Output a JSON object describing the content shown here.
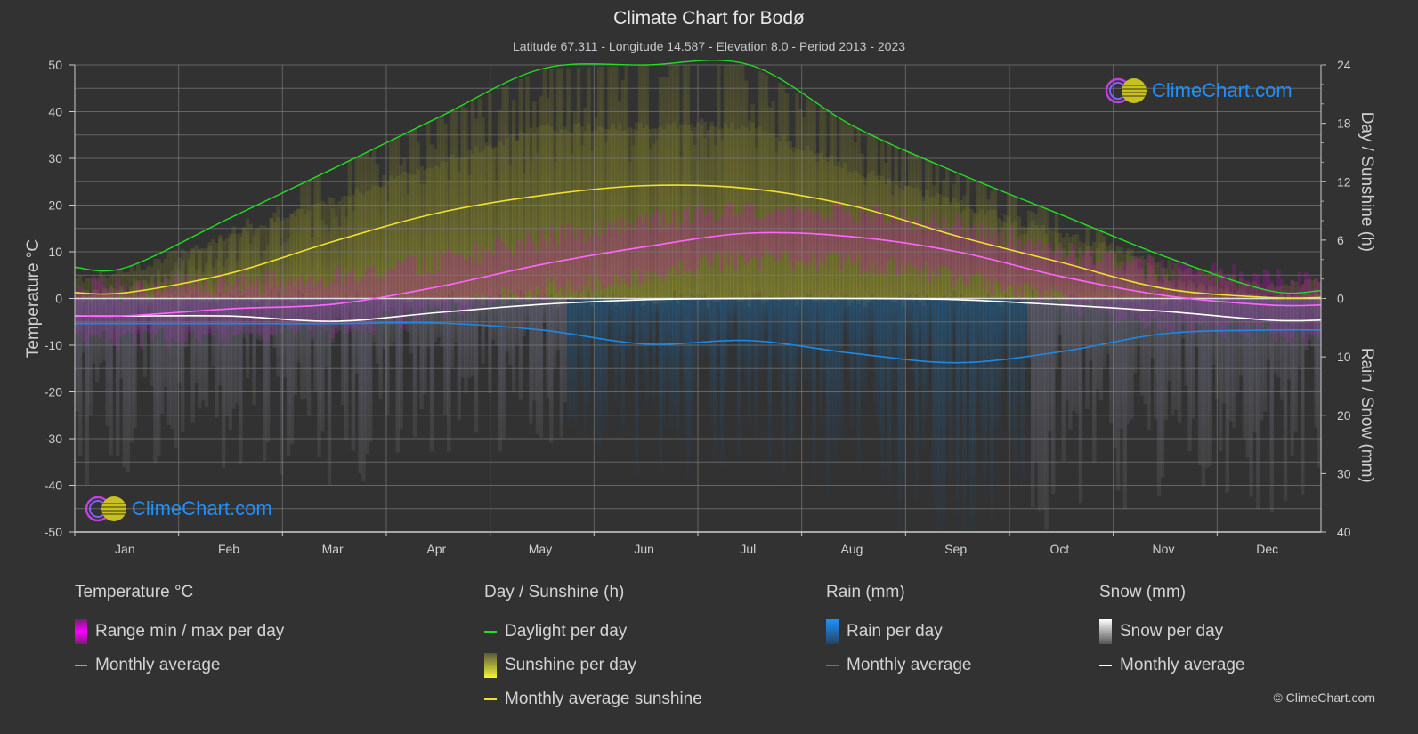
{
  "header": {
    "title": "Climate Chart for Bodø",
    "subtitle": "Latitude 67.311 - Longitude 14.587 - Elevation 8.0 - Period 2013 - 2023"
  },
  "logo": {
    "text": "ClimeChart.com"
  },
  "copyright": "© ClimeChart.com",
  "colors": {
    "background": "#323232",
    "grid": "#5a5a5a",
    "temp_avg": "#ff66ff",
    "temp_range": "#e100e1",
    "daylight": "#22dd22",
    "sunshine_avg": "#f0e030",
    "sunshine_bar": "#9a9a28",
    "rain_avg": "#1e88e5",
    "rain_bar": "#1f6aa5",
    "snow_avg": "#ffffff",
    "snow_bar": "#9a9a9a",
    "logo": "#1e90ff"
  },
  "legend": {
    "temperature": {
      "title": "Temperature °C",
      "items": [
        {
          "label": "Range min / max per day",
          "icon": "magenta-gradient-bar"
        },
        {
          "label": "Monthly average",
          "icon": "pink-line"
        }
      ]
    },
    "sunshine": {
      "title": "Day / Sunshine (h)",
      "items": [
        {
          "label": "Daylight per day",
          "icon": "green-line"
        },
        {
          "label": "Sunshine per day",
          "icon": "yellow-gradient-bar"
        },
        {
          "label": "Monthly average sunshine",
          "icon": "yellow-line"
        }
      ]
    },
    "rain": {
      "title": "Rain (mm)",
      "items": [
        {
          "label": "Rain per day",
          "icon": "blue-gradient-bar"
        },
        {
          "label": "Monthly average",
          "icon": "blue-line"
        }
      ]
    },
    "snow": {
      "title": "Snow (mm)",
      "items": [
        {
          "label": "Snow per day",
          "icon": "white-gradient-bar"
        },
        {
          "label": "Monthly average",
          "icon": "white-line"
        }
      ]
    }
  },
  "chart_data": {
    "type": "line",
    "title": "Climate Chart for Bodø",
    "categories": [
      "Jan",
      "Feb",
      "Mar",
      "Apr",
      "May",
      "Jun",
      "Jul",
      "Aug",
      "Sep",
      "Oct",
      "Nov",
      "Dec"
    ],
    "axes": {
      "left": {
        "label": "Temperature °C",
        "range": [
          -50,
          50
        ],
        "ticks": [
          50,
          40,
          30,
          20,
          10,
          0,
          -10,
          -20,
          -30,
          -40,
          -50
        ]
      },
      "right_top": {
        "label": "Day / Sunshine (h)",
        "range": [
          0,
          24
        ],
        "ticks": [
          24,
          18,
          12,
          6,
          0
        ]
      },
      "right_bottom": {
        "label": "Rain / Snow (mm)",
        "range": [
          0,
          40
        ],
        "ticks": [
          10,
          20,
          30,
          40
        ]
      }
    },
    "grid": true,
    "series": [
      {
        "name": "Temperature monthly average",
        "axis": "left",
        "unit": "°C",
        "values": [
          -3.7,
          -2.2,
          -1.2,
          2.5,
          7.3,
          11.1,
          14.0,
          13.2,
          10.0,
          4.7,
          0.6,
          -1.4
        ]
      },
      {
        "name": "Daylight per day",
        "axis": "right_top",
        "unit": "h",
        "values": [
          3.2,
          8.3,
          13.4,
          18.6,
          23.6,
          24.0,
          24.0,
          17.7,
          12.9,
          8.6,
          4.3,
          0.8
        ]
      },
      {
        "name": "Monthly average sunshine",
        "axis": "right_top",
        "unit": "h",
        "values": [
          0.6,
          2.6,
          5.9,
          8.8,
          10.6,
          11.6,
          11.3,
          9.5,
          6.4,
          3.7,
          1.0,
          0.1
        ]
      },
      {
        "name": "Rain monthly average",
        "axis": "right_bottom",
        "unit": "mm",
        "values": [
          4.3,
          4.3,
          4.3,
          4.2,
          5.4,
          7.8,
          7.2,
          9.4,
          11.0,
          9.1,
          6.0,
          5.4
        ]
      },
      {
        "name": "Snow monthly average",
        "axis": "right_bottom",
        "unit": "mm",
        "values": [
          3.0,
          3.0,
          3.9,
          2.4,
          1.0,
          0.2,
          0.0,
          0.0,
          0.2,
          1.1,
          2.2,
          3.7
        ]
      }
    ]
  }
}
